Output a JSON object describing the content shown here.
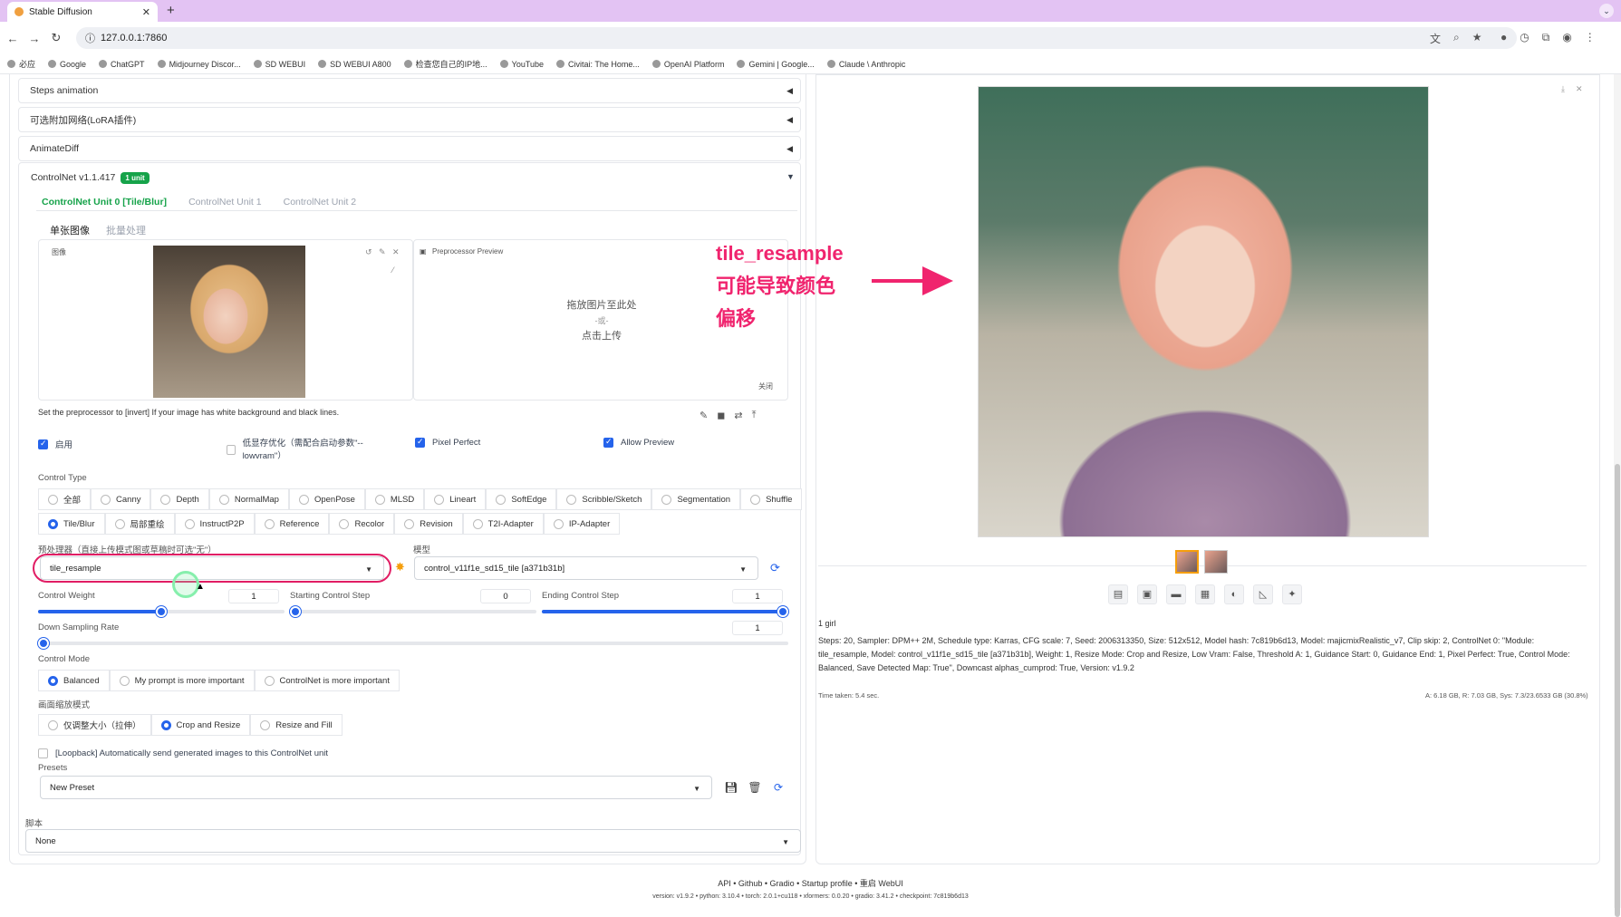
{
  "browser": {
    "tab_title": "Stable Diffusion",
    "url": "127.0.0.1:7860",
    "bookmarks": [
      "必应",
      "Google",
      "ChatGPT",
      "Midjourney Discor...",
      "SD WEBUI",
      "SD WEBUI A800",
      "检查您自己的IP地...",
      "YouTube",
      "Civitai: The Home...",
      "OpenAI Platform",
      "Gemini | Google...",
      "Claude \\ Anthropic"
    ]
  },
  "accordions": {
    "steps": "Steps animation",
    "lora": "可选附加网络(LoRA插件)",
    "animatediff": "AnimateDiff"
  },
  "controlnet": {
    "title": "ControlNet v1.1.417",
    "badge": "1 unit",
    "units": [
      "ControlNet Unit 0 [Tile/Blur]",
      "ControlNet Unit 1",
      "ControlNet Unit 2"
    ],
    "subtabs": [
      "单张图像",
      "批量处理"
    ],
    "image_label": "图像",
    "preview_label": "Preprocessor Preview",
    "drop_text": "拖放图片至此处",
    "or_text": "-或-",
    "click_text": "点击上传",
    "close": "关闭",
    "hint": "Set the preprocessor to [invert] If your image has white background and black lines.",
    "enable": "启用",
    "lowvram": "低显存优化（需配合启动参数\"--lowvram\"）",
    "pixel_perfect": "Pixel Perfect",
    "allow_preview": "Allow Preview",
    "control_type_label": "Control Type",
    "control_types_row1": [
      "全部",
      "Canny",
      "Depth",
      "NormalMap",
      "OpenPose",
      "MLSD",
      "Lineart",
      "SoftEdge",
      "Scribble/Sketch",
      "Segmentation",
      "Shuffle"
    ],
    "control_types_row2": [
      "Tile/Blur",
      "局部重绘",
      "InstructP2P",
      "Reference",
      "Recolor",
      "Revision",
      "T2I-Adapter",
      "IP-Adapter"
    ],
    "selected_type": "Tile/Blur",
    "preprocessor_label": "预处理器（直接上传模式图或草稿时可选\"无\"）",
    "preprocessor": "tile_resample",
    "model_label": "模型",
    "model": "control_v11f1e_sd15_tile [a371b31b]",
    "control_weight_label": "Control Weight",
    "control_weight": "1",
    "control_weight_frac": 0.5,
    "start_step_label": "Starting Control Step",
    "start_step": "0",
    "start_step_frac": 0,
    "end_step_label": "Ending Control Step",
    "end_step": "1",
    "end_step_frac": 1,
    "down_sampling_label": "Down Sampling Rate",
    "down_sampling": "1",
    "down_sampling_frac": 0,
    "control_mode_label": "Control Mode",
    "control_modes": [
      "Balanced",
      "My prompt is more important",
      "ControlNet is more important"
    ],
    "resize_label": "画面缩放模式",
    "resize_modes": [
      "仅调整大小（拉伸）",
      "Crop and Resize",
      "Resize and Fill"
    ],
    "loopback": "[Loopback] Automatically send generated images to this ControlNet unit",
    "presets_label": "Presets",
    "preset": "New Preset"
  },
  "script": {
    "label": "脚本",
    "value": "None"
  },
  "output": {
    "prompt": "1 girl",
    "params": "Steps: 20, Sampler: DPM++ 2M, Schedule type: Karras, CFG scale: 7, Seed: 2006313350, Size: 512x512, Model hash: 7c819b6d13, Model: majicmixRealistic_v7, Clip skip: 2, ControlNet 0: \"Module: tile_resample, Model: control_v11f1e_sd15_tile [a371b31b], Weight: 1, Resize Mode: Crop and Resize, Low Vram: False, Threshold A: 1, Guidance Start: 0, Guidance End: 1, Pixel Perfect: True, Control Mode: Balanced, Save Detected Map: True\", Downcast alphas_cumprod: True, Version: v1.9.2",
    "time_taken": "Time taken: 5.4 sec.",
    "vram": "A: 6.18 GB, R: 7.03 GB, Sys: 7.3/23.6533 GB (30.8%)"
  },
  "annotation": [
    "tile_resample",
    "可能导致颜色",
    "偏移"
  ],
  "footer": {
    "links": "API • Github • Gradio • Startup profile • 重启 WebUI",
    "versions": "version: v1.9.2  •  python: 3.10.4  •  torch: 2.0.1+cu118  •  xformers: 0.0.20  •  gradio: 3.41.2  •  checkpoint: 7c819b6d13"
  },
  "colors": {
    "accent": "#2563eb",
    "green": "#16a34a",
    "annotation": "#f0246e"
  }
}
